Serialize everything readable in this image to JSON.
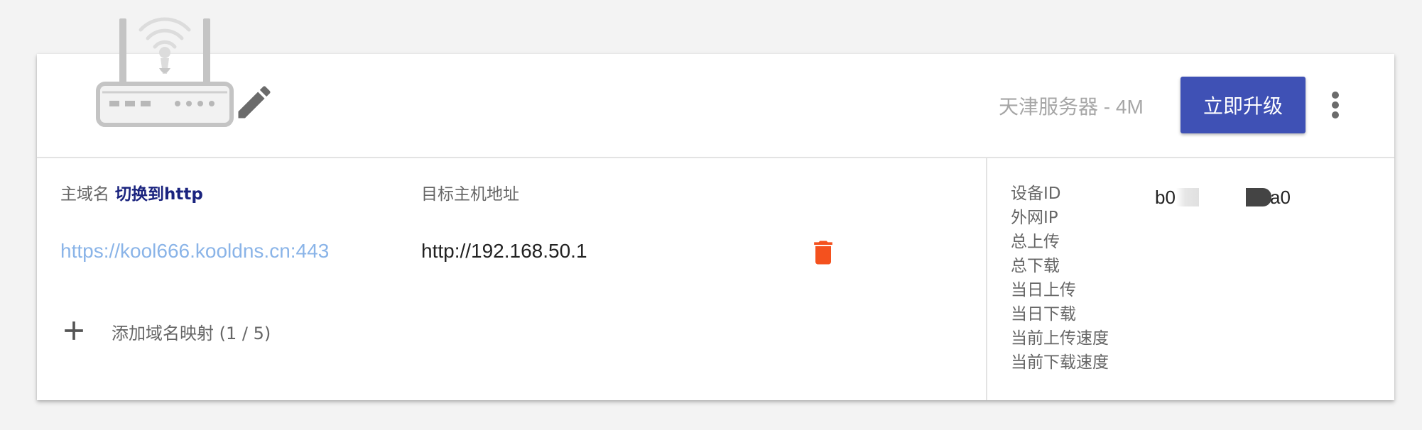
{
  "header": {
    "plan_text": "天津服务器 - 4M",
    "upgrade_label": "立即升级",
    "icons": {
      "router": "router-icon",
      "edit": "pencil-edit-icon",
      "more": "more-vert-icon"
    }
  },
  "mappings": {
    "col_domain_label": "主域名",
    "switch_link": "切换到http",
    "col_target_label": "目标主机地址",
    "rows": [
      {
        "domain": "https://kool666.kooldns.cn:443",
        "target": "http://192.168.50.1"
      }
    ],
    "add_label": "添加域名映射 (1 / 5)"
  },
  "device_info": {
    "labels": [
      "设备ID",
      "外网IP",
      "总上传",
      "总下载",
      "当日上传",
      "当日下载",
      "当前上传速度",
      "当前下载速度"
    ],
    "device_id_visible_start": "b0",
    "device_id_visible_end": "a0"
  },
  "colors": {
    "accent": "#3f51b5",
    "delete": "#f4511e",
    "link": "#8ab4e8",
    "switch_link": "#1a237e"
  }
}
